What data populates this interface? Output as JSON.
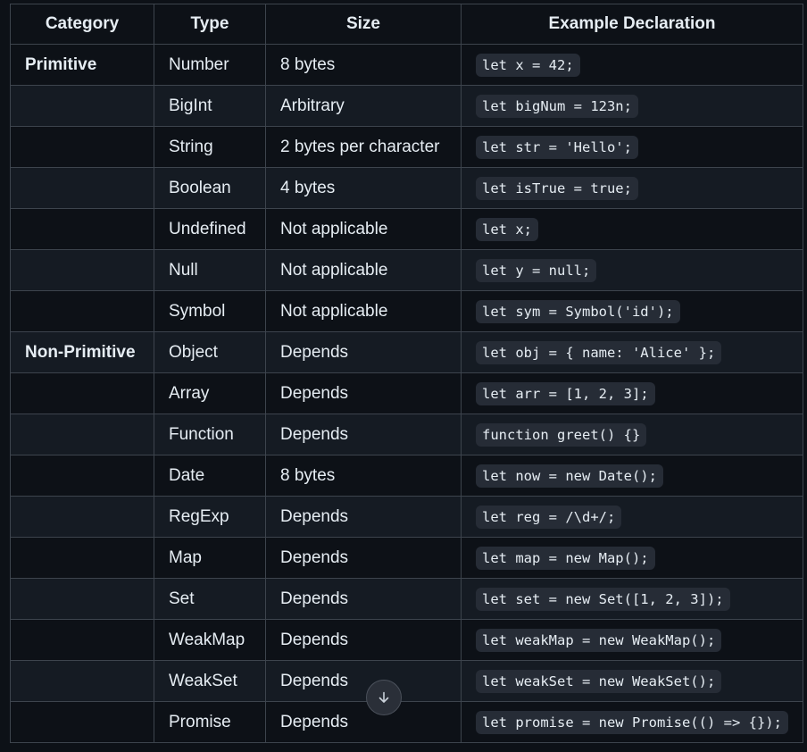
{
  "table": {
    "headers": [
      "Category",
      "Type",
      "Size",
      "Example Declaration"
    ],
    "rows": [
      {
        "category": "Primitive",
        "type": "Number",
        "size": "8 bytes",
        "example": "let x = 42;"
      },
      {
        "category": "",
        "type": "BigInt",
        "size": "Arbitrary",
        "example": "let bigNum = 123n;"
      },
      {
        "category": "",
        "type": "String",
        "size": "2 bytes per character",
        "example": "let str = 'Hello';"
      },
      {
        "category": "",
        "type": "Boolean",
        "size": "4 bytes",
        "example": "let isTrue = true;"
      },
      {
        "category": "",
        "type": "Undefined",
        "size": "Not applicable",
        "example": "let x;"
      },
      {
        "category": "",
        "type": "Null",
        "size": "Not applicable",
        "example": "let y = null;"
      },
      {
        "category": "",
        "type": "Symbol",
        "size": "Not applicable",
        "example": "let sym = Symbol('id');"
      },
      {
        "category": "Non-Primitive",
        "type": "Object",
        "size": "Depends",
        "example": "let obj = { name: 'Alice' };"
      },
      {
        "category": "",
        "type": "Array",
        "size": "Depends",
        "example": "let arr = [1, 2, 3];"
      },
      {
        "category": "",
        "type": "Function",
        "size": "Depends",
        "example": "function greet() {}"
      },
      {
        "category": "",
        "type": "Date",
        "size": "8 bytes",
        "example": "let now = new Date();"
      },
      {
        "category": "",
        "type": "RegExp",
        "size": "Depends",
        "example": "let reg = /\\d+/;"
      },
      {
        "category": "",
        "type": "Map",
        "size": "Depends",
        "example": "let map = new Map();"
      },
      {
        "category": "",
        "type": "Set",
        "size": "Depends",
        "example": "let set = new Set([1, 2, 3]);"
      },
      {
        "category": "",
        "type": "WeakMap",
        "size": "Depends",
        "example": "let weakMap = new WeakMap();"
      },
      {
        "category": "",
        "type": "WeakSet",
        "size": "Depends",
        "example": "let weakSet = new WeakSet();"
      },
      {
        "category": "",
        "type": "Promise",
        "size": "Depends",
        "example": "let promise = new Promise(() => {});"
      }
    ]
  },
  "scroll_button": {
    "icon": "arrow-down-icon"
  },
  "colors": {
    "background": "#0d1117",
    "row_alt": "#151b23",
    "border": "#3d444d",
    "code_bg": "#262c36",
    "text": "#e6edf3"
  }
}
